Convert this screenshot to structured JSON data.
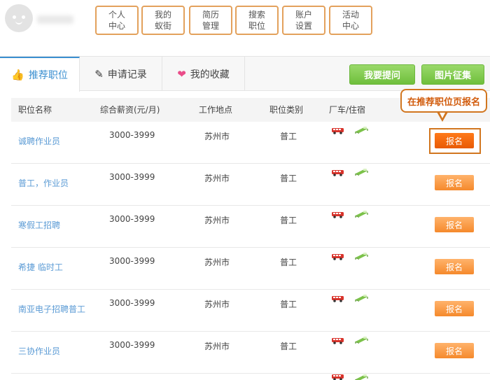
{
  "top_nav": [
    {
      "label": "个人\n中心"
    },
    {
      "label": "我的\n蚁街"
    },
    {
      "label": "简历\n管理"
    },
    {
      "label": "搜索\n职位"
    },
    {
      "label": "账户\n设置"
    },
    {
      "label": "活动\n中心"
    }
  ],
  "tabs": [
    {
      "label": "推荐职位",
      "icon": "thumbs-up-icon",
      "active": true
    },
    {
      "label": "申请记录",
      "icon": "edit-icon",
      "active": false
    },
    {
      "label": "我的收藏",
      "icon": "heart-icon",
      "active": false
    }
  ],
  "actions": {
    "ask_label": "我要提问",
    "photo_label": "图片征集"
  },
  "table": {
    "headers": [
      "职位名称",
      "综合薪资(元/月)",
      "工作地点",
      "职位类别",
      "厂车/住宿"
    ],
    "rows": [
      {
        "name": "诚聘作业员",
        "salary": "3000-3999",
        "location": "苏州市",
        "category": "普工",
        "apply": "报名"
      },
      {
        "name": "普工，作业员",
        "salary": "3000-3999",
        "location": "苏州市",
        "category": "普工",
        "apply": "报名"
      },
      {
        "name": "寒假工招聘",
        "salary": "3000-3999",
        "location": "苏州市",
        "category": "普工",
        "apply": "报名"
      },
      {
        "name": "希捷 临时工",
        "salary": "3000-3999",
        "location": "苏州市",
        "category": "普工",
        "apply": "报名"
      },
      {
        "name": "南亚电子招聘普工",
        "salary": "3000-3999",
        "location": "苏州市",
        "category": "普工",
        "apply": "报名"
      },
      {
        "name": "三协作业员",
        "salary": "3000-3999",
        "location": "苏州市",
        "category": "普工",
        "apply": "报名"
      }
    ]
  },
  "annotation": {
    "callout_text": "在推荐职位页报名"
  },
  "colors": {
    "accent_blue": "#3a8fd0",
    "apply_orange": "#f5892c",
    "highlight_orange": "#d1761f",
    "green": "#6fbf3c"
  }
}
